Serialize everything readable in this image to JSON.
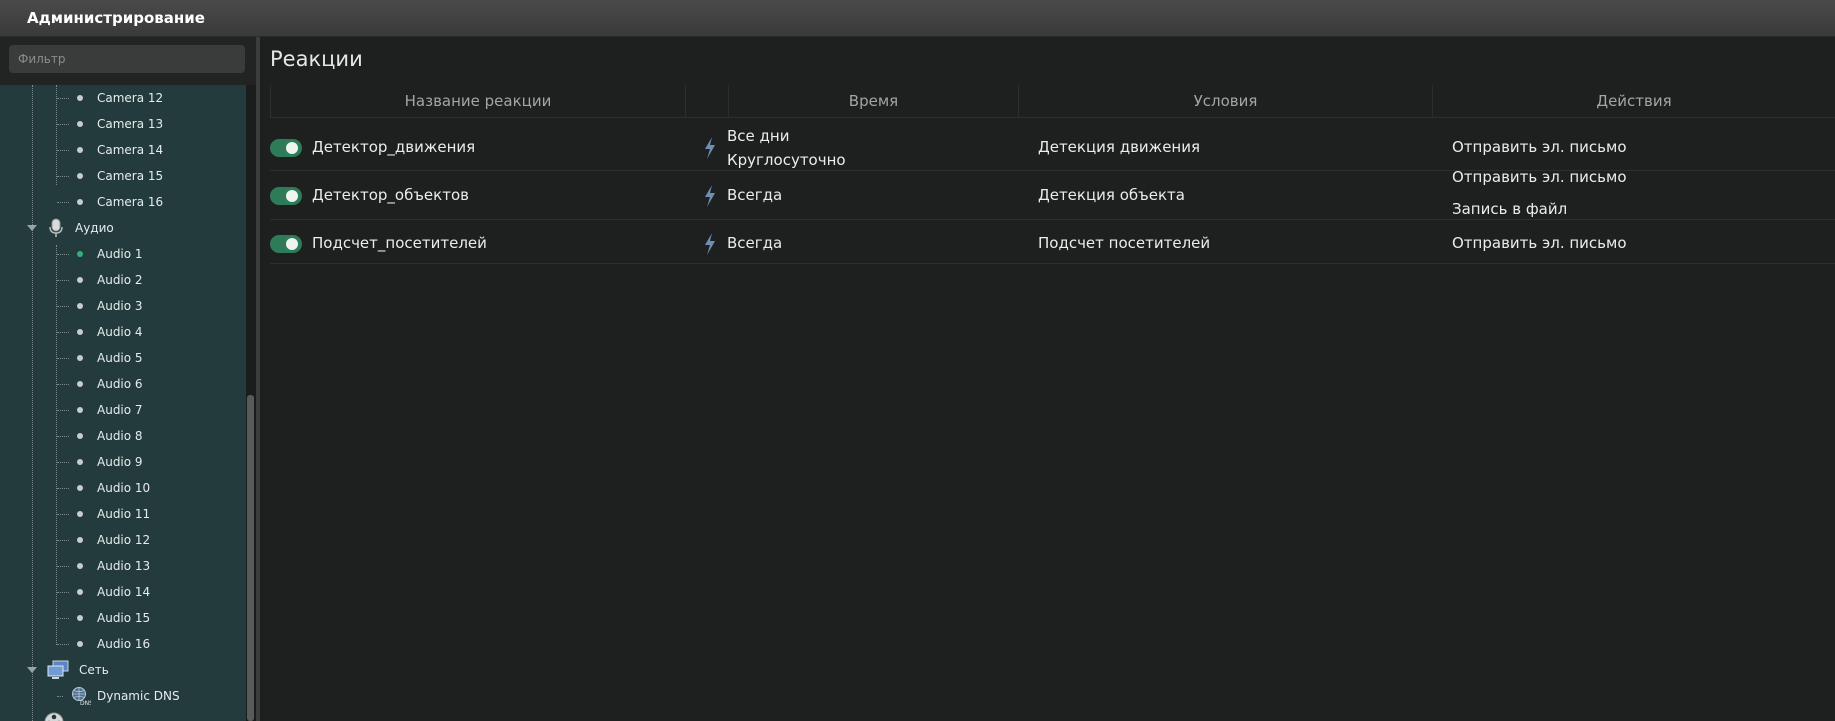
{
  "window": {
    "title": "Администрирование"
  },
  "sidebar": {
    "filter_placeholder": "Фильтр",
    "cameras": [
      "Camera 12",
      "Camera 13",
      "Camera 14",
      "Camera 15",
      "Camera 16"
    ],
    "audio_group": {
      "label": "Аудио",
      "icon": "microphone-icon",
      "items": [
        "Audio 1",
        "Audio 2",
        "Audio 3",
        "Audio 4",
        "Audio 5",
        "Audio 6",
        "Audio 7",
        "Audio 8",
        "Audio 9",
        "Audio 10",
        "Audio 11",
        "Audio 12",
        "Audio 13",
        "Audio 14",
        "Audio 15",
        "Audio 16"
      ],
      "active_item": "Audio 1"
    },
    "network_group": {
      "label": "Сеть",
      "icon": "network-monitors-icon",
      "items": [
        {
          "label": "Dynamic DNS",
          "icon": "dns-globe-icon"
        }
      ]
    }
  },
  "main": {
    "title": "Реакции",
    "columns": {
      "name": "Название реакции",
      "time": "Время",
      "conditions": "Условия",
      "actions": "Действия"
    },
    "reactions": [
      {
        "enabled": true,
        "name": "Детектор_движения",
        "time_line1": "Все дни",
        "time_line2": "Круглосуточно",
        "condition": "Детекция движения",
        "action1": "Отправить эл. письмо",
        "action2": ""
      },
      {
        "enabled": true,
        "name": "Детектор_объектов",
        "time_line1": "Всегда",
        "time_line2": "",
        "condition": "Детекция объекта",
        "action1": "Отправить эл. письмо",
        "action2": "Запись в файл"
      },
      {
        "enabled": true,
        "name": "Подсчет_посетителей",
        "time_line1": "Всегда",
        "time_line2": "",
        "condition": "Подсчет посетителей",
        "action1": "Отправить эл. письмо",
        "action2": ""
      }
    ]
  },
  "colors": {
    "tree_background": "#243b3d",
    "toggle_on": "#2f7a58",
    "active_dot": "#33b07a"
  }
}
